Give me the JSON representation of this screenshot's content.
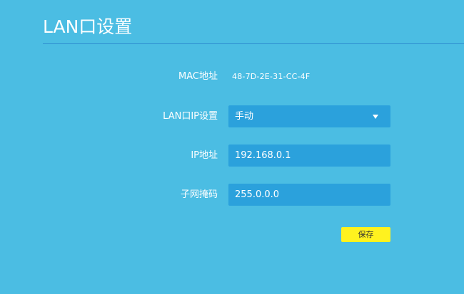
{
  "page": {
    "title": "LAN口设置"
  },
  "form": {
    "mac": {
      "label": "MAC地址",
      "value": "48-7D-2E-31-CC-4F"
    },
    "ip_mode": {
      "label": "LAN口IP设置",
      "selected": "手动"
    },
    "ip": {
      "label": "IP地址",
      "value": "192.168.0.1"
    },
    "netmask": {
      "label": "子网掩码",
      "value": "255.0.0.0"
    }
  },
  "actions": {
    "save_label": "保存"
  },
  "colors": {
    "background": "#4bbde3",
    "field": "#2ba1dc",
    "divider": "#2f8fd1",
    "save_button": "#fff21f"
  },
  "icons": {
    "select_caret": "caret-down-icon"
  }
}
